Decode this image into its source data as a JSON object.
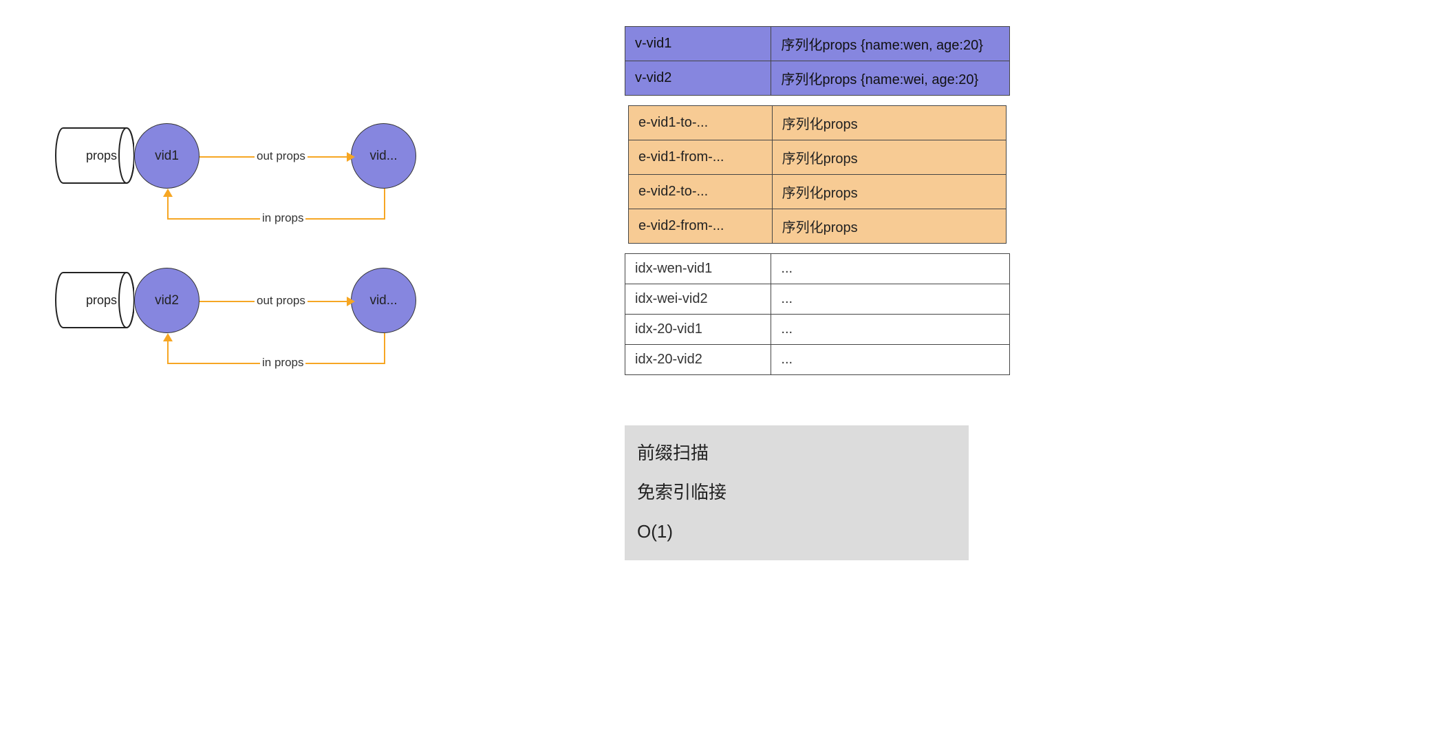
{
  "graphs": [
    {
      "props_label": "props",
      "node_a": "vid1",
      "node_b": "vid...",
      "out_label": "out props",
      "in_label": "in props"
    },
    {
      "props_label": "props",
      "node_a": "vid2",
      "node_b": "vid...",
      "out_label": "out props",
      "in_label": "in props"
    }
  ],
  "vertex_table": [
    {
      "key": "v-vid1",
      "val": "序列化props {name:wen, age:20}"
    },
    {
      "key": "v-vid2",
      "val": "序列化props {name:wei, age:20}"
    }
  ],
  "edge_table": [
    {
      "key": "e-vid1-to-...",
      "val": "序列化props"
    },
    {
      "key": "e-vid1-from-...",
      "val": "序列化props"
    },
    {
      "key": "e-vid2-to-...",
      "val": "序列化props"
    },
    {
      "key": "e-vid2-from-...",
      "val": "序列化props"
    }
  ],
  "index_table": [
    {
      "key": "idx-wen-vid1",
      "val": "..."
    },
    {
      "key": "idx-wei-vid2",
      "val": "..."
    },
    {
      "key": "idx-20-vid1",
      "val": "..."
    },
    {
      "key": "idx-20-vid2",
      "val": "..."
    }
  ],
  "notes": {
    "line1": "前缀扫描",
    "line2": "免索引临接",
    "line3": "O(1)"
  },
  "colors": {
    "node_fill": "#8686DF",
    "edge_fill": "#F7CB94",
    "arrow": "#F6A623",
    "notes_bg": "#DCDCDC"
  }
}
